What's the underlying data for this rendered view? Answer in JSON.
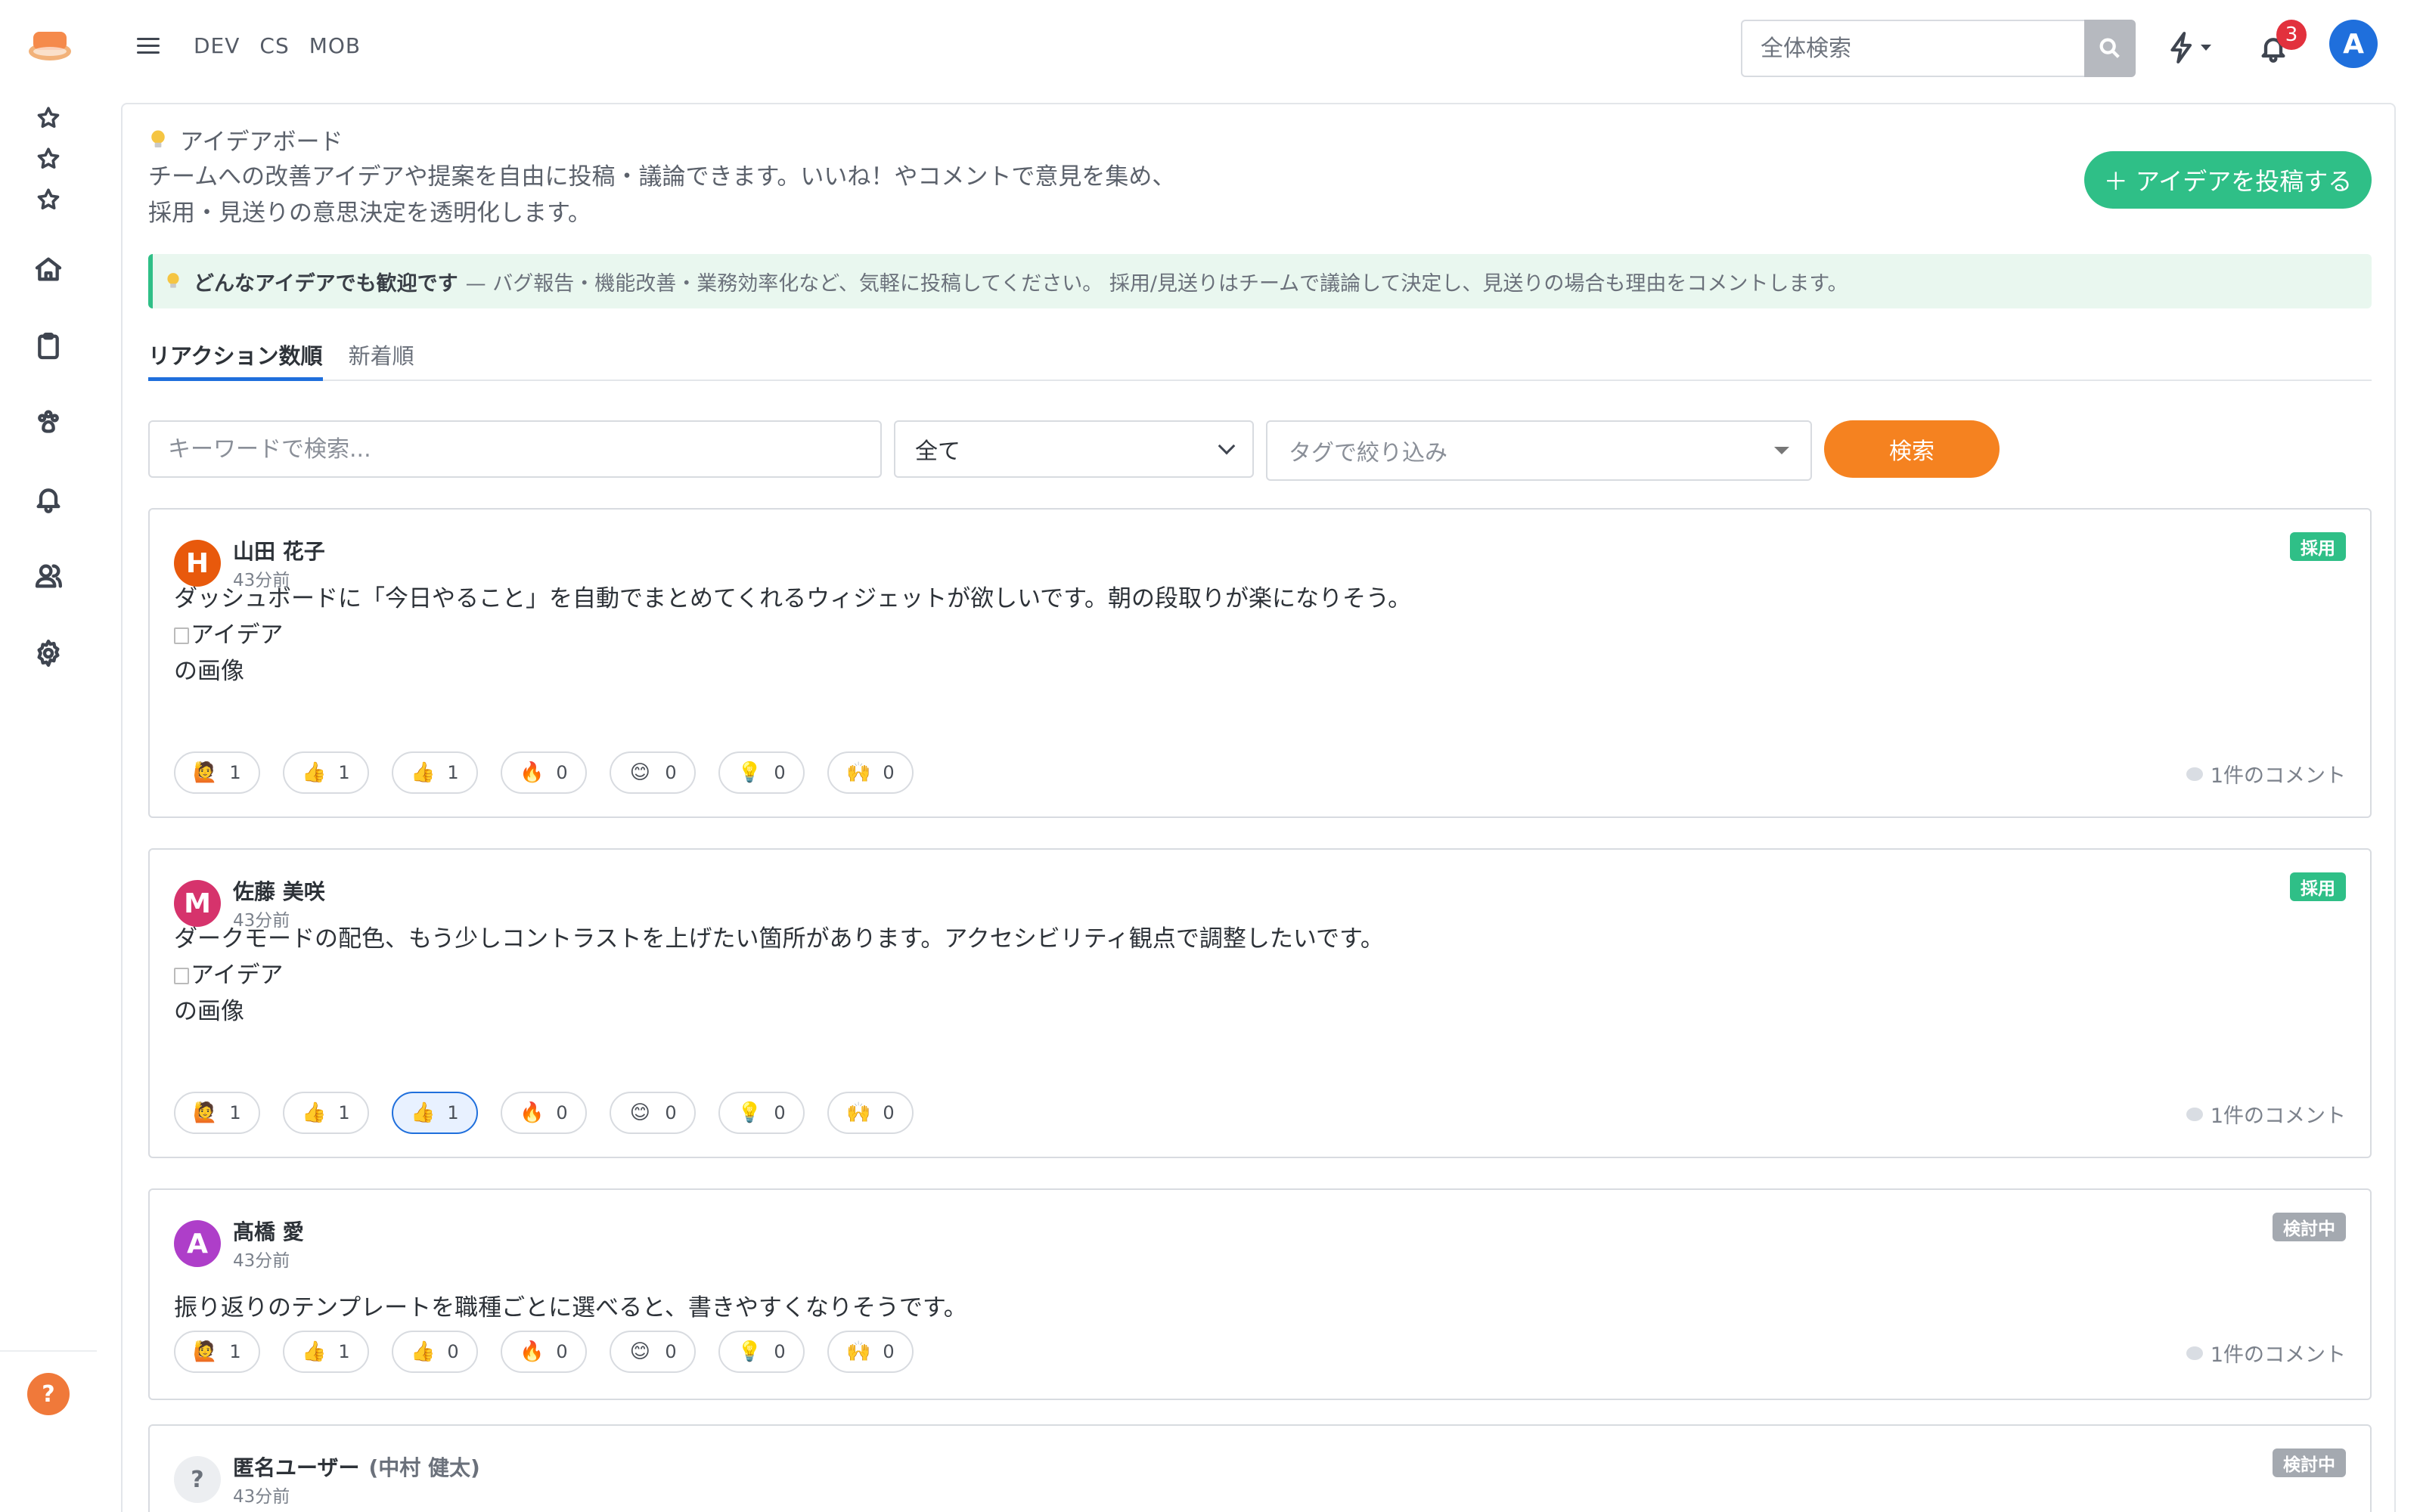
{
  "nav": {
    "items": [
      "DEV",
      "CS",
      "MOB"
    ]
  },
  "global_search": {
    "placeholder": "全体検索"
  },
  "notifications": {
    "count": "3"
  },
  "user": {
    "initial": "A"
  },
  "help": {
    "label": "?"
  },
  "board": {
    "title": "アイデアボード",
    "description_line1": "チームへの改善アイデアや提案を自由に投稿・議論できます。いいね！やコメントで意見を集め、",
    "description_line2": "採用・見送りの意思決定を透明化します。",
    "post_button": "＋ アイデアを投稿する"
  },
  "notice": {
    "bold": "どんなアイデアでも歓迎です",
    "text": "— バグ報告・機能改善・業務効率化など、気軽に投稿してください。 採用/見送りはチームで議論して決定し、見送りの場合も理由をコメントします。"
  },
  "tabs": [
    "リアクション数順",
    "新着順"
  ],
  "filters": {
    "keyword_placeholder": "キーワードで検索...",
    "status_value": "全て",
    "tag_placeholder": "タグで絞り込み",
    "search_button": "検索"
  },
  "colors": {
    "adopted": "#2fbf87",
    "reviewing": "#a4a9b0",
    "primary": "#1f6fdc",
    "accent_orange": "#f58220"
  },
  "reaction_emojis": [
    "🙋",
    "👍",
    "👍",
    "🔥",
    "😊",
    "💡",
    "🙌"
  ],
  "posts": [
    {
      "author": "山田 花子",
      "initial": "H",
      "avatar_color": "#e8590c",
      "time": "43分前",
      "status": "採用",
      "body": "ダッシュボードに「今日やること」を自動でまとめてくれるウィジェットが欲しいです。朝の段取りが楽になりそう。",
      "image_alt_1": "アイデア",
      "image_alt_2": "の画像",
      "reactions": [
        "1",
        "1",
        "1",
        "0",
        "0",
        "0",
        "0"
      ],
      "comments": "1件のコメント"
    },
    {
      "author": "佐藤 美咲",
      "initial": "M",
      "avatar_color": "#d6336c",
      "time": "43分前",
      "status": "採用",
      "body": "ダークモードの配色、もう少しコントラストを上げたい箇所があります。アクセシビリティ観点で調整したいです。",
      "image_alt_1": "アイデア",
      "image_alt_2": "の画像",
      "reactions": [
        "1",
        "1",
        "1",
        "0",
        "0",
        "0",
        "0"
      ],
      "comments": "1件のコメント"
    },
    {
      "author": "髙橋 愛",
      "initial": "A",
      "avatar_color": "#ae3ec9",
      "time": "43分前",
      "status": "検討中",
      "body": "振り返りのテンプレートを職種ごとに選べると、書きやすくなりそうです。",
      "reactions": [
        "1",
        "1",
        "0",
        "0",
        "0",
        "0",
        "0"
      ],
      "comments": "1件のコメント"
    },
    {
      "author": "匿名ユーザー",
      "author_sub": "(中村 健太)",
      "initial": "?",
      "time": "43分前",
      "status": "検討中"
    }
  ]
}
